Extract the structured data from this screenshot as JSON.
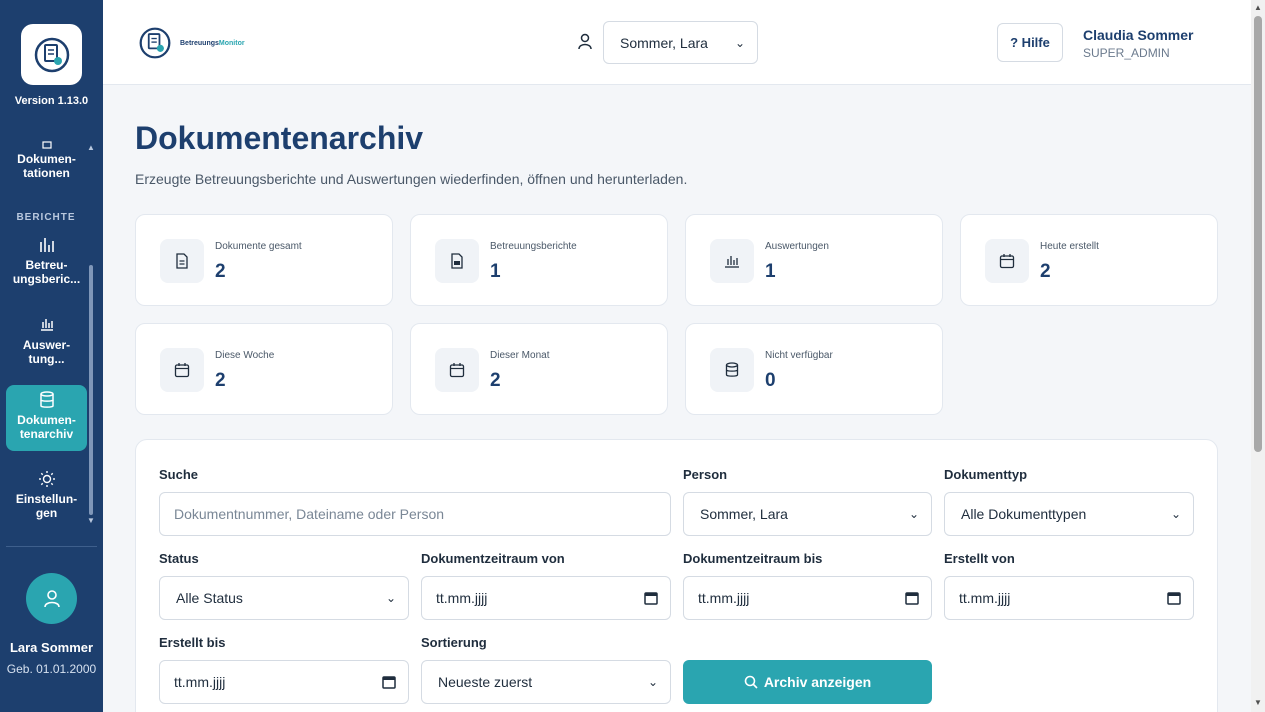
{
  "sidebar": {
    "version": "Version 1.13.0",
    "section_reports": "BERICHTE",
    "items": [
      {
        "label": "Dokumen-tationen",
        "icon": "document-icon"
      },
      {
        "label": "Betreu-ungsberic...",
        "icon": "bar-chart-icon"
      },
      {
        "label": "Auswer-tung...",
        "icon": "chart-icon"
      },
      {
        "label": "Dokumen-tenarchiv",
        "icon": "database-icon",
        "active": true
      },
      {
        "label": "Einstellun-gen",
        "icon": "settings-sun-icon"
      }
    ],
    "user": {
      "name": "Lara Sommer",
      "dob": "Geb. 01.01.2000"
    }
  },
  "header": {
    "brand_main": "Betreuungs",
    "brand_accent": "Monitor",
    "person_select": "Sommer, Lara",
    "help_label": "? Hilfe",
    "user_name": "Claudia Sommer",
    "user_role": "SUPER_ADMIN"
  },
  "page": {
    "title": "Dokumentenarchiv",
    "subtitle": "Erzeugte Betreuungsberichte und Auswertungen wiederfinden, öffnen und herunterladen."
  },
  "stats": [
    {
      "label": "Dokumente gesamt",
      "value": "2",
      "icon": "file-icon"
    },
    {
      "label": "Betreuungsberichte",
      "value": "1",
      "icon": "pdf-file-icon"
    },
    {
      "label": "Auswertungen",
      "value": "1",
      "icon": "bar-chart-icon"
    },
    {
      "label": "Heute erstellt",
      "value": "2",
      "icon": "calendar-icon"
    },
    {
      "label": "Diese Woche",
      "value": "2",
      "icon": "calendar-icon"
    },
    {
      "label": "Dieser Monat",
      "value": "2",
      "icon": "calendar-icon"
    },
    {
      "label": "Nicht verfügbar",
      "value": "0",
      "icon": "database-icon"
    }
  ],
  "filters": {
    "search_label": "Suche",
    "search_placeholder": "Dokumentnummer, Dateiname oder Person",
    "person_label": "Person",
    "person_value": "Sommer, Lara",
    "doctype_label": "Dokumenttyp",
    "doctype_value": "Alle Dokumenttypen",
    "status_label": "Status",
    "status_value": "Alle Status",
    "period_from_label": "Dokumentzeitraum von",
    "period_to_label": "Dokumentzeitraum bis",
    "created_from_label": "Erstellt von",
    "created_to_label": "Erstellt bis",
    "sort_label": "Sortierung",
    "sort_value": "Neueste zuerst",
    "date_placeholder": "tt.mm.jjjj",
    "submit_label": "Archiv anzeigen"
  }
}
